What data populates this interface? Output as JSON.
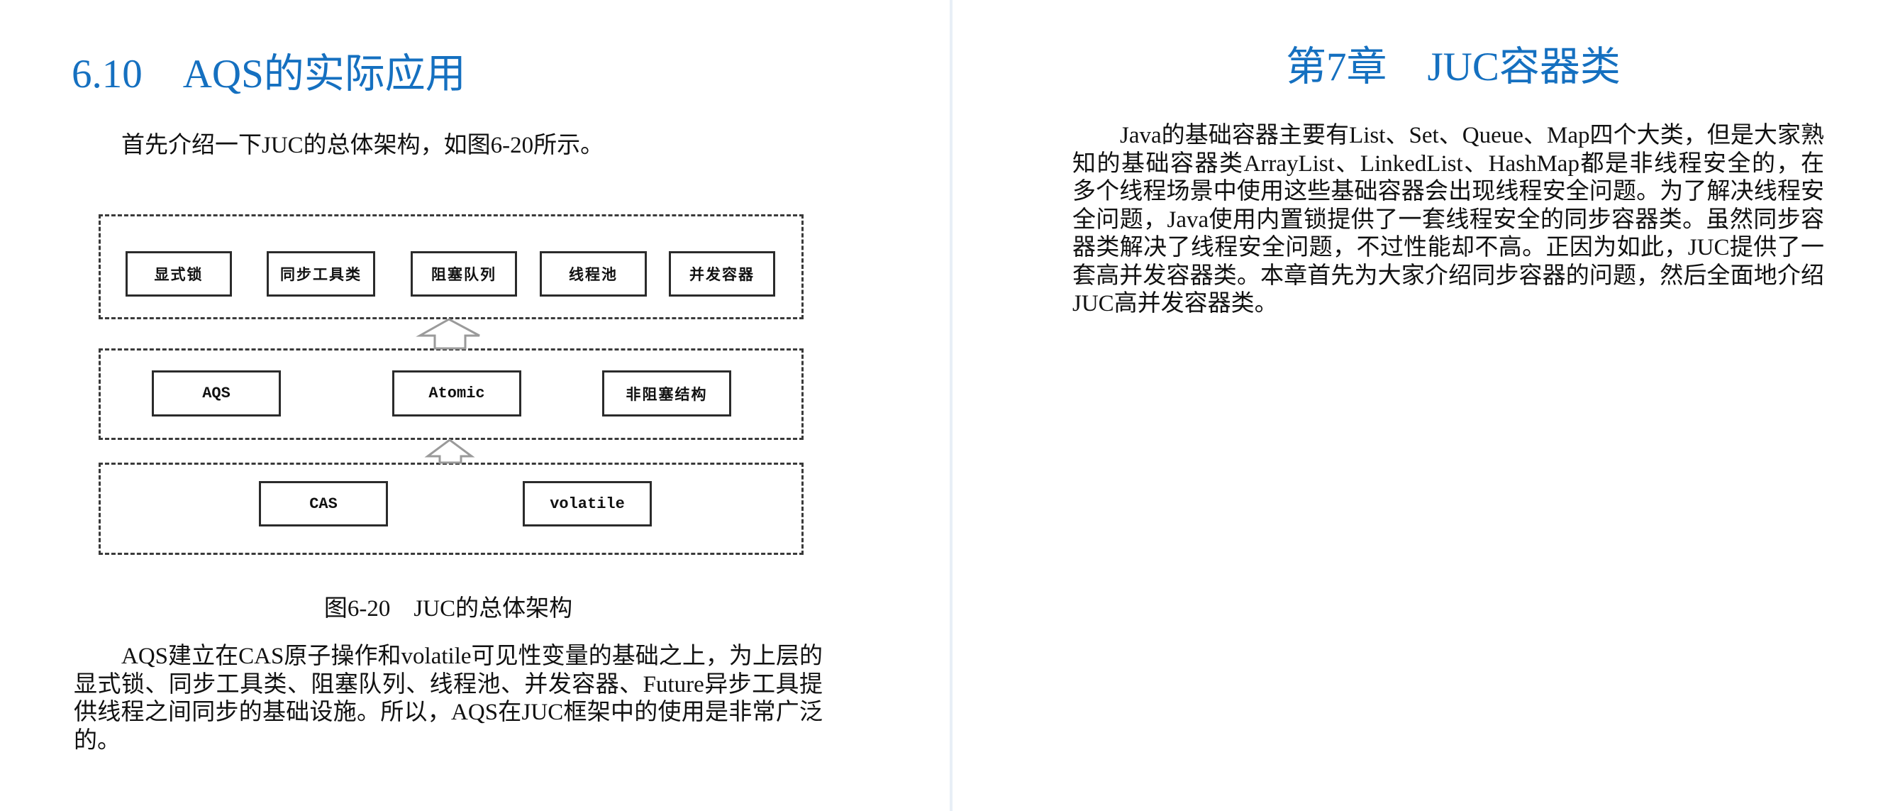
{
  "left_page": {
    "section_title": "6.10　AQS的实际应用",
    "intro_text": "首先介绍一下JUC的总体架构，如图6-20所示。",
    "figure": {
      "layers": [
        {
          "name": "top",
          "nodes": [
            "显式锁",
            "同步工具类",
            "阻塞队列",
            "线程池",
            "并发容器"
          ]
        },
        {
          "name": "middle",
          "nodes": [
            "AQS",
            "Atomic",
            "非阻塞结构"
          ]
        },
        {
          "name": "bottom",
          "nodes": [
            "CAS",
            "volatile"
          ]
        }
      ],
      "caption": "图6-20　JUC的总体架构"
    },
    "paragraph": "AQS建立在CAS原子操作和volatile可见性变量的基础之上，为上层的显式锁、同步工具类、阻塞队列、线程池、并发容器、Future异步工具提供线程之间同步的基础设施。所以，AQS在JUC框架中的使用是非常广泛的。"
  },
  "right_page": {
    "chapter_title": "第7章　JUC容器类",
    "paragraph": "Java的基础容器主要有List、Set、Queue、Map四个大类，但是大家熟知的基础容器类ArrayList、LinkedList、HashMap都是非线程安全的，在多个线程场景中使用这些基础容器会出现线程安全问题。为了解决线程安全问题，Java使用内置锁提供了一套线程安全的同步容器类。虽然同步容器类解决了线程安全问题，不过性能却不高。正因为如此，JUC提供了一套高并发容器类。本章首先为大家介绍同步容器的问题，然后全面地介绍JUC高并发容器类。"
  },
  "colors": {
    "heading": "#1570C0",
    "body_text": "#111111",
    "page_divider": "#E8EFF6",
    "diagram_border": "#2b2b2b",
    "arrow": "#9a9a9a"
  }
}
